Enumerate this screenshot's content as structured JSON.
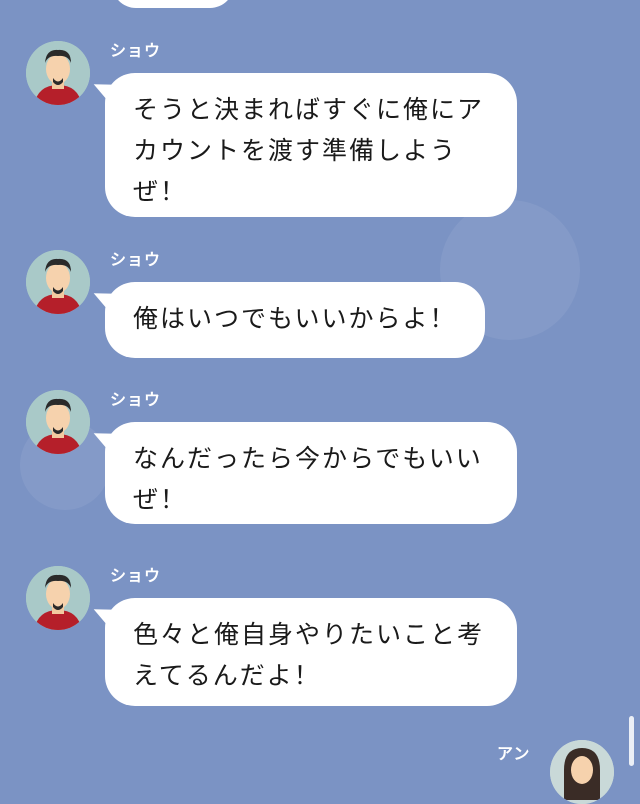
{
  "messages": [
    {
      "sender": "ショウ",
      "text": "そうと決まればすぐに俺にアカウントを渡す準備しようぜ！"
    },
    {
      "sender": "ショウ",
      "text": "俺はいつでもいいからよ！"
    },
    {
      "sender": "ショウ",
      "text": "なんだったら今からでもいいぜ！"
    },
    {
      "sender": "ショウ",
      "text": "色々と俺自身やりたいこと考えてるんだよ！"
    }
  ],
  "next_sender": "アン",
  "colors": {
    "background": "#7b93c4",
    "bubble": "#ffffff",
    "sender_text": "#ffffff"
  },
  "icons": {
    "avatar_left": "man-avatar-icon",
    "avatar_right": "woman-avatar-icon"
  }
}
